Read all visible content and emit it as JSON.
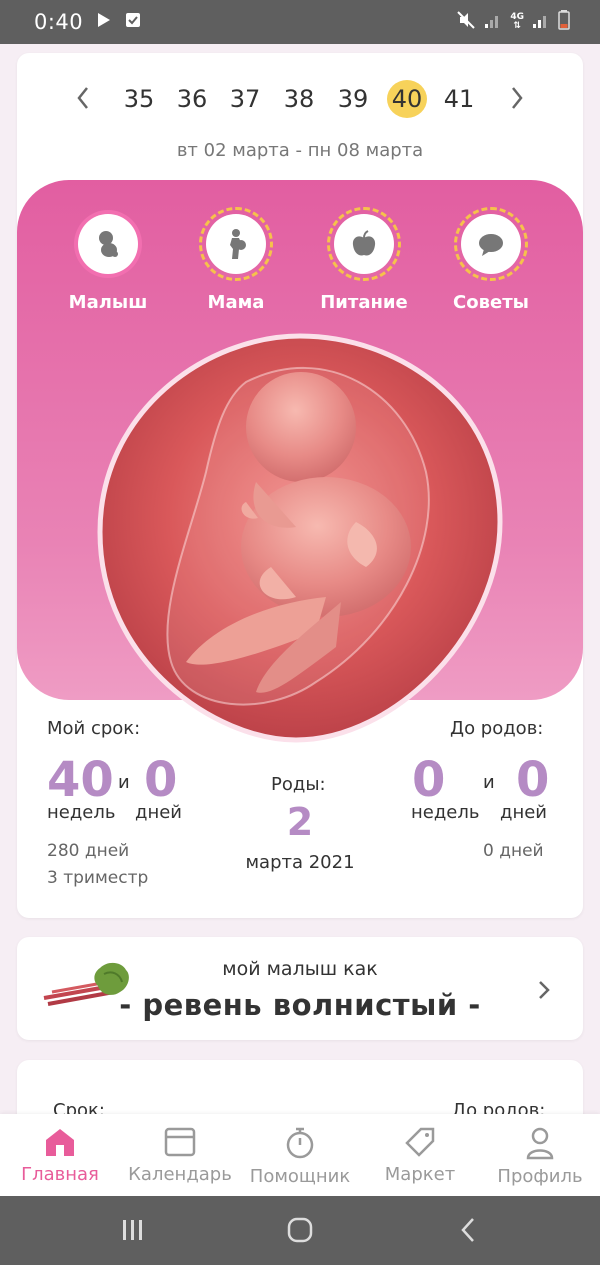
{
  "status": {
    "time": "0:40"
  },
  "weeks": {
    "items": [
      "35",
      "36",
      "37",
      "38",
      "39",
      "40",
      "41"
    ],
    "selected": "40"
  },
  "range": "вт 02 марта - пн 08 марта",
  "tabs": [
    {
      "label": "Малыш",
      "icon": "baby-icon"
    },
    {
      "label": "Мама",
      "icon": "mom-icon"
    },
    {
      "label": "Питание",
      "icon": "apple-icon"
    },
    {
      "label": "Советы",
      "icon": "chat-icon"
    }
  ],
  "my_term": {
    "label": "Мой срок:",
    "weeks": "40",
    "and": "и",
    "days": "0",
    "weeks_unit": "недель",
    "days_unit": "дней",
    "total_days": "280 дней",
    "trimester": "3 триместр"
  },
  "birth": {
    "label": "Роды:",
    "day": "2",
    "month_year": "марта 2021"
  },
  "until_birth": {
    "label": "До родов:",
    "weeks": "0",
    "and": "и",
    "days": "0",
    "weeks_unit": "недель",
    "days_unit": "дней",
    "total_days": "0 дней"
  },
  "baby_size": {
    "prefix": "мой малыш как",
    "name": "- ревень волнистый -"
  },
  "third_card": {
    "left": "Срок:",
    "right": "До родов:"
  },
  "bottom_nav": [
    {
      "label": "Главная",
      "icon": "home-icon",
      "active": true
    },
    {
      "label": "Календарь",
      "icon": "calendar-icon",
      "active": false
    },
    {
      "label": "Помощник",
      "icon": "stopwatch-icon",
      "active": false
    },
    {
      "label": "Маркет",
      "icon": "tag-icon",
      "active": false
    },
    {
      "label": "Профиль",
      "icon": "profile-icon",
      "active": false
    }
  ],
  "colors": {
    "accent": "#e85c9a",
    "highlight": "#f7d25a",
    "number": "#b58bc4",
    "pink_top": "#e25ea1"
  }
}
